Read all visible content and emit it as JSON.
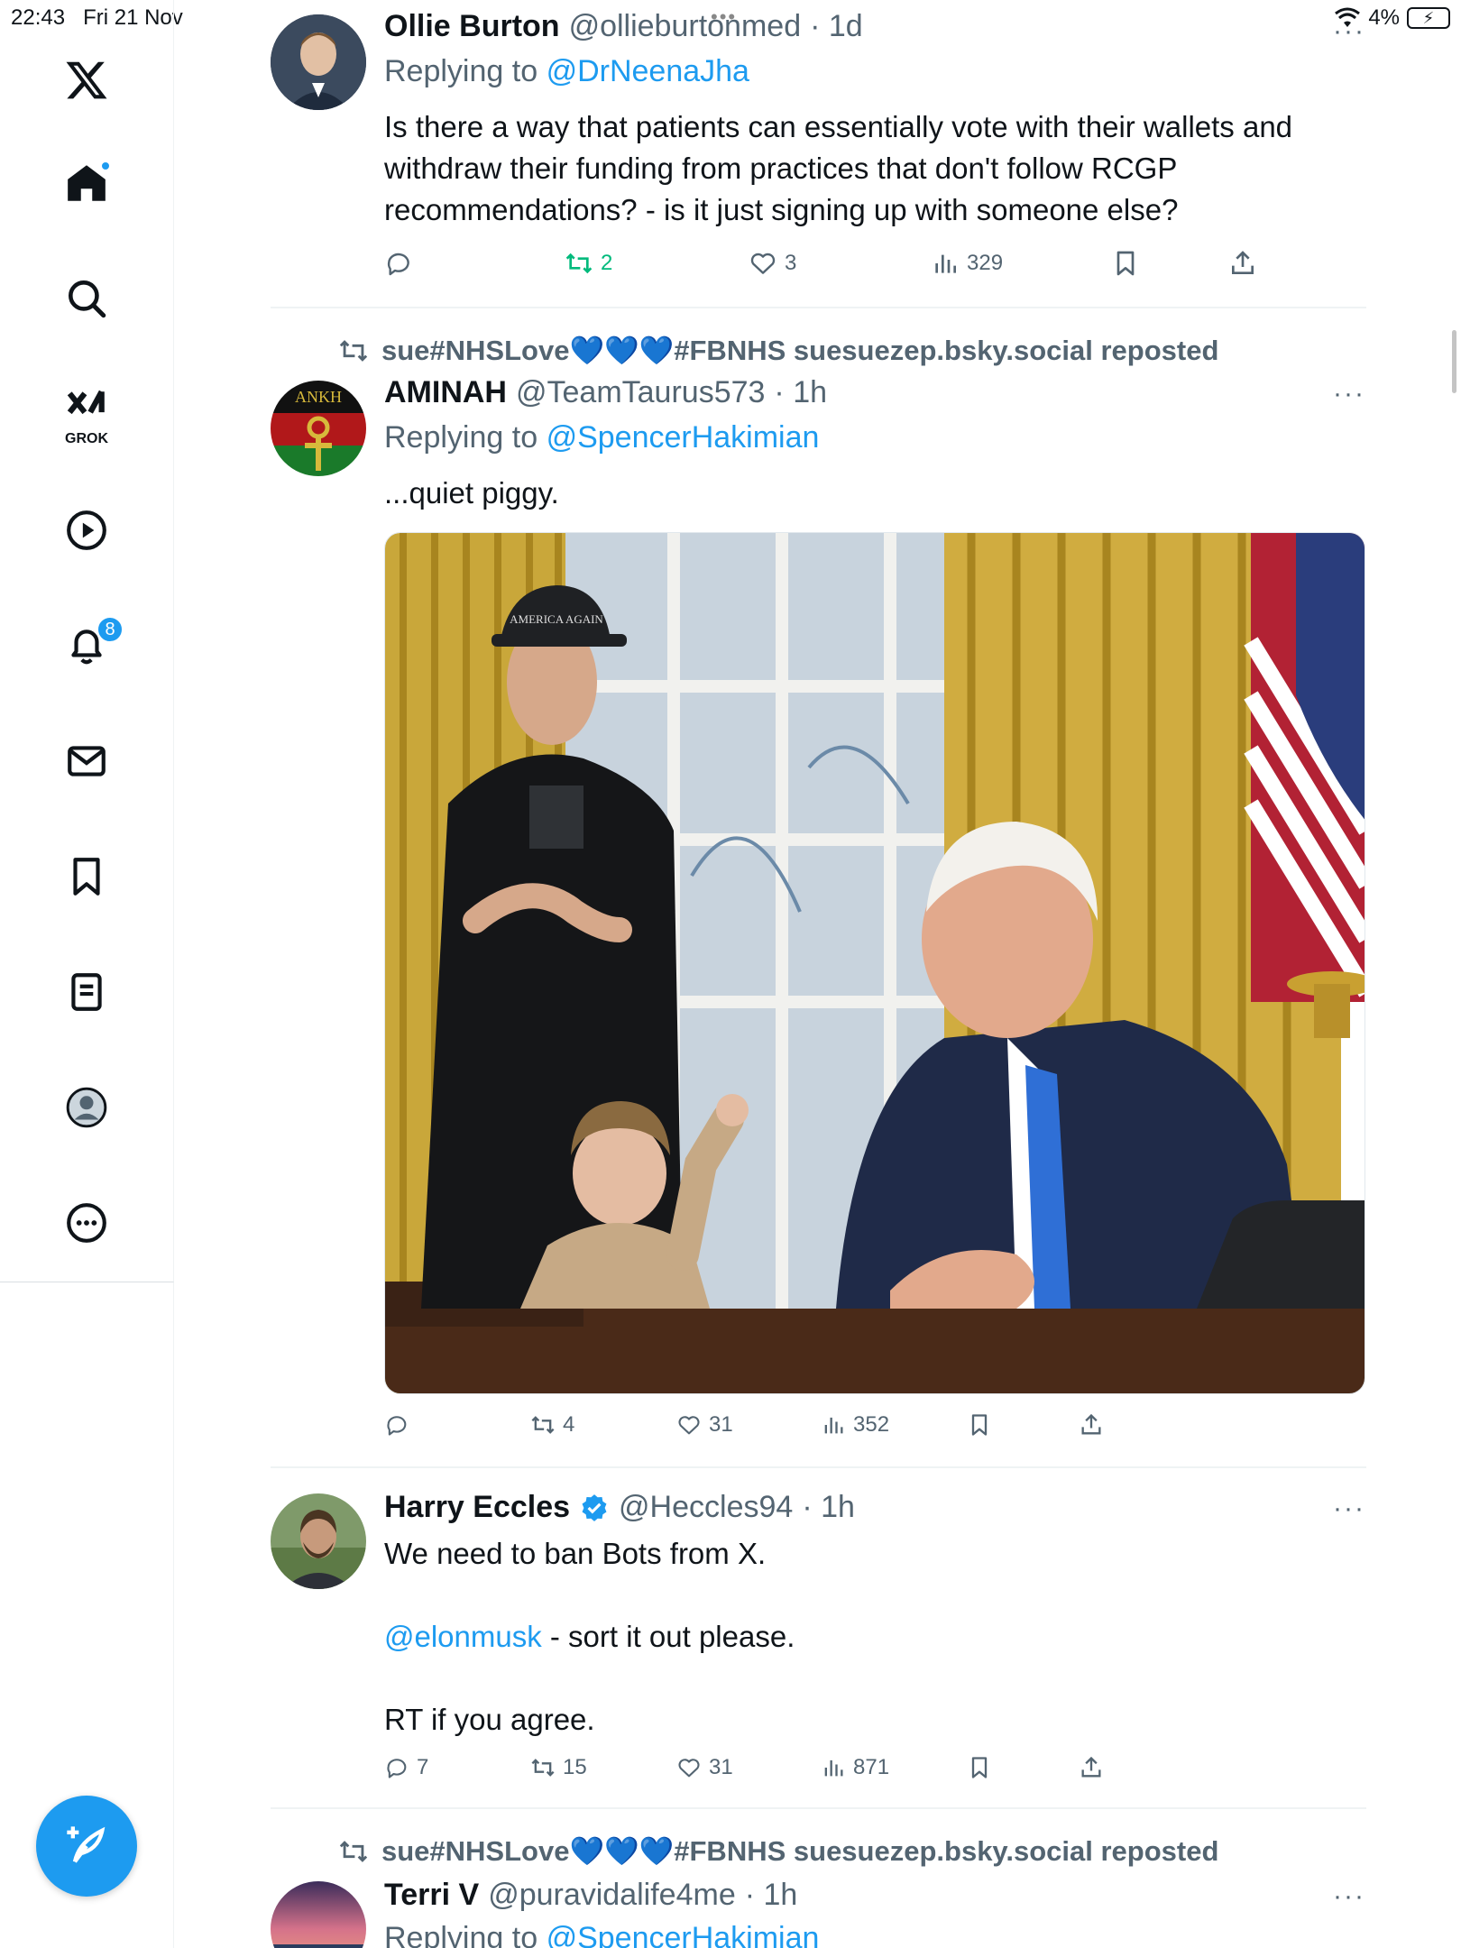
{
  "status_bar": {
    "time": "22:43",
    "date": "Fri 21 Nov",
    "battery": "4%",
    "dots": "•••"
  },
  "sidebar": {
    "items": [
      {
        "name": "logo"
      },
      {
        "name": "home"
      },
      {
        "name": "search"
      },
      {
        "name": "grok",
        "label": "GROK"
      },
      {
        "name": "video"
      },
      {
        "name": "notifications",
        "badge": "8"
      },
      {
        "name": "messages"
      },
      {
        "name": "bookmarks"
      },
      {
        "name": "lists"
      },
      {
        "name": "profile"
      },
      {
        "name": "more"
      }
    ]
  },
  "tweets": [
    {
      "name": "Ollie Burton",
      "handle": "@ollieburtonmed",
      "time": "· 1d",
      "reply_prefix": "Replying to",
      "reply_to": "@DrNeenaJha",
      "text_lines": [
        "Is there a way that patients can essentially vote with their wallets and",
        "withdraw their funding from practices that don't follow RCGP",
        "recommendations? - is it just signing up with someone else?"
      ],
      "retweets": "2",
      "likes": "3",
      "views": "329"
    },
    {
      "repost_by": "sue#NHSLove💙💙💙#FBNHS suesuezep.bsky.social reposted",
      "name": "AMINAH",
      "handle": "@TeamTaurus573",
      "time": "· 1h",
      "reply_prefix": "Replying to",
      "reply_to": "@SpencerHakimian",
      "text": "...quiet piggy.",
      "retweets": "4",
      "likes": "31",
      "views": "352",
      "avatar_text": "ANKH"
    },
    {
      "name": "Harry Eccles",
      "handle": "@Heccles94",
      "time": "· 1h",
      "text_line1": "We need to ban Bots from X.",
      "mention": "@elonmusk",
      "text_line2": " - sort it out please.",
      "text_line3": "RT if you agree.",
      "replies": "7",
      "retweets": "15",
      "likes": "31",
      "views": "871"
    },
    {
      "repost_by": "sue#NHSLove💙💙💙#FBNHS suesuezep.bsky.social reposted",
      "name": "Terri V",
      "handle": "@puravidalife4me",
      "time": "· 1h",
      "reply_prefix": "Replying to",
      "reply_to": "@SpencerHakimian"
    }
  ],
  "image_cap_text": "AMERICA AGAIN",
  "more_glyph": "···",
  "colors": {
    "accent": "#1d9bf0",
    "retweet_green": "#00ba7c",
    "muted": "#536471"
  }
}
